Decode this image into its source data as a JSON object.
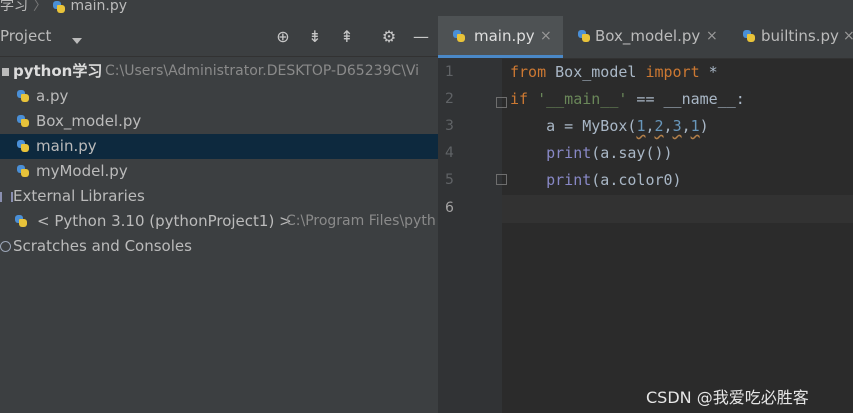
{
  "breadcrumb": {
    "project_tail": "学习",
    "separator": "〉",
    "file": "main.py"
  },
  "project_panel": {
    "title": "Project",
    "icons": [
      "crosshair-icon",
      "collapse-all-icon",
      "expand-all-icon",
      "gear-icon",
      "minimize-icon"
    ],
    "root": {
      "name": "python学习",
      "path": "C:\\Users\\Administrator.DESKTOP-D65239C\\Vi"
    },
    "files": [
      {
        "name": "a.py"
      },
      {
        "name": "Box_model.py"
      },
      {
        "name": "main.py",
        "selected": true
      },
      {
        "name": "myModel.py"
      }
    ],
    "external_libraries": "External Libraries",
    "python_sdk": {
      "label": "< Python 3.10 (pythonProject1) >",
      "path": "C:\\Program Files\\pyth"
    },
    "scratches": "Scratches and Consoles"
  },
  "editor": {
    "tabs": [
      {
        "label": "main.py",
        "active": true
      },
      {
        "label": "Box_model.py",
        "active": false
      },
      {
        "label": "builtins.py",
        "active": false
      }
    ],
    "close_glyph": "×",
    "line_numbers": [
      "1",
      "2",
      "3",
      "4",
      "5",
      "6"
    ],
    "current_line": "6",
    "code": {
      "l1_from": "from",
      "l1_module": " Box_model ",
      "l1_import": "import",
      "l1_star": " *",
      "l2_if": "if",
      "l2_space": " ",
      "l2_str": "'__main__'",
      "l2_rest": " == __name__:",
      "l3_indent": "    a = MyBox(",
      "l3_n1": "1",
      "l3_c1": ",",
      "l3_n2": "2",
      "l3_c2": ",",
      "l3_n3": "3",
      "l3_c3": ",",
      "l3_n4": "1",
      "l3_end": ")",
      "l4_indent": "    ",
      "l4_print": "print",
      "l4_rest": "(a.say())",
      "l5_indent": "    ",
      "l5_print": "print",
      "l5_rest": "(a.color0)"
    }
  },
  "watermark": "CSDN @我爱吃必胜客",
  "colors": {
    "keyword": "#cc7832",
    "string": "#6a8759",
    "number": "#6897bb",
    "builtin": "#8888c6",
    "selection": "#0d293e",
    "tab_accent": "#4a88c7"
  }
}
